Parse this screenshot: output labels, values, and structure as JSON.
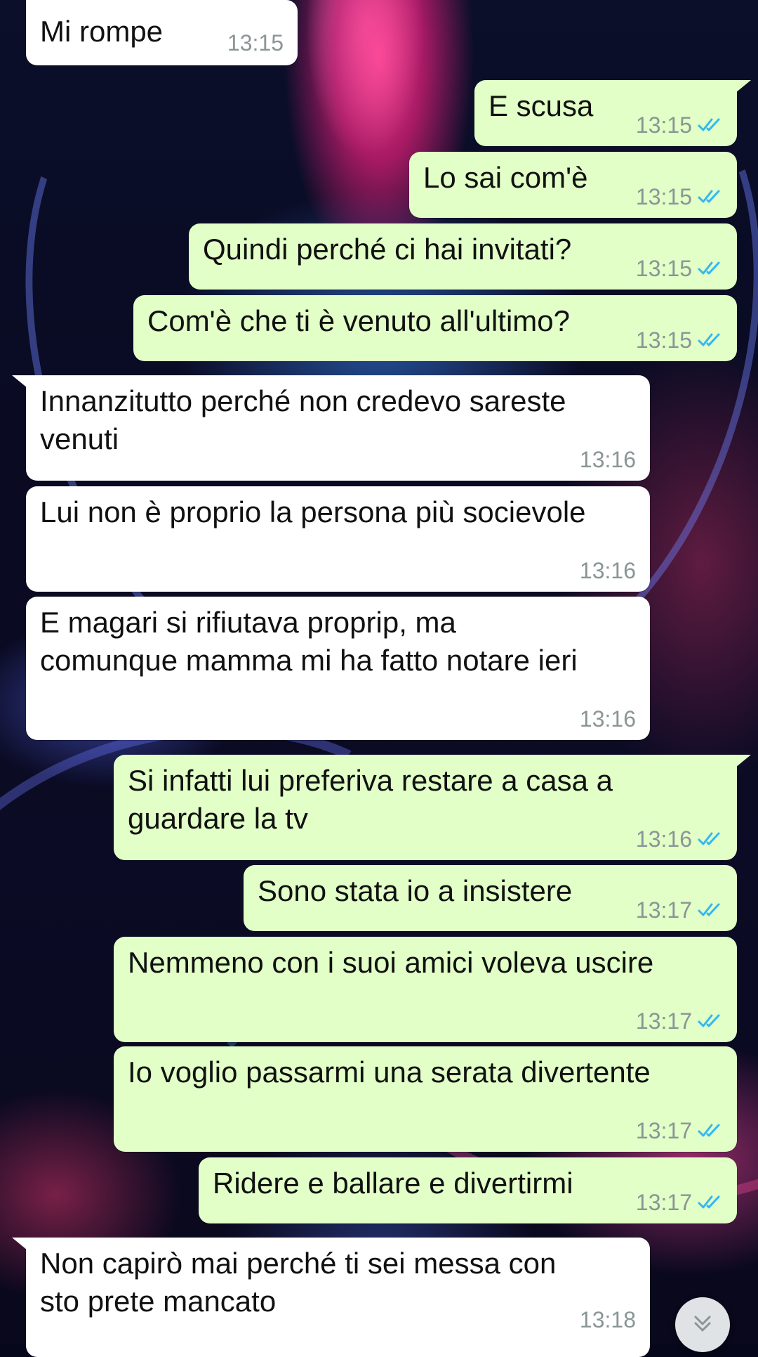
{
  "colors": {
    "incoming_bubble": "#ffffff",
    "outgoing_bubble": "#e1ffc7",
    "text": "#111111",
    "time": "#8a9596",
    "read_ticks": "#34b7f1"
  },
  "messages": [
    {
      "direction": "in",
      "text": "Mi rompe",
      "time": "13:15"
    },
    {
      "direction": "out",
      "text": "E scusa",
      "time": "13:15",
      "status_icon": "double-check-icon"
    },
    {
      "direction": "out",
      "text": "Lo sai com'è",
      "time": "13:15",
      "status_icon": "double-check-icon"
    },
    {
      "direction": "out",
      "text": "Quindi perché ci hai invitati?",
      "time": "13:15",
      "status_icon": "double-check-icon"
    },
    {
      "direction": "out",
      "text": "Com'è che ti è venuto all'ultimo?",
      "time": "13:15",
      "status_icon": "double-check-icon"
    },
    {
      "direction": "in",
      "text": "Innanzitutto perché non credevo sareste\nvenuti",
      "time": "13:16"
    },
    {
      "direction": "in",
      "text": "Lui non è proprio la persona più socievole",
      "time": "13:16"
    },
    {
      "direction": "in",
      "text": "E magari si rifiutava proprip, ma\ncomunque mamma mi ha fatto notare ieri",
      "time": "13:16"
    },
    {
      "direction": "out",
      "text": "Si infatti lui preferiva restare a casa a\nguardare la tv",
      "time": "13:16",
      "status_icon": "double-check-icon"
    },
    {
      "direction": "out",
      "text": "Sono stata io a insistere",
      "time": "13:17",
      "status_icon": "double-check-icon"
    },
    {
      "direction": "out",
      "text": "Nemmeno con i suoi amici voleva uscire",
      "time": "13:17",
      "status_icon": "double-check-icon"
    },
    {
      "direction": "out",
      "text": "Io voglio passarmi una serata divertente",
      "time": "13:17",
      "status_icon": "double-check-icon"
    },
    {
      "direction": "out",
      "text": "Ridere e ballare e divertirmi",
      "time": "13:17",
      "status_icon": "double-check-icon"
    },
    {
      "direction": "in",
      "text": "Non capirò mai perché ti sei messa con\nsto prete mancato",
      "time": "13:18"
    }
  ],
  "scroll_button": {
    "icon": "double-chevron-down-icon"
  }
}
